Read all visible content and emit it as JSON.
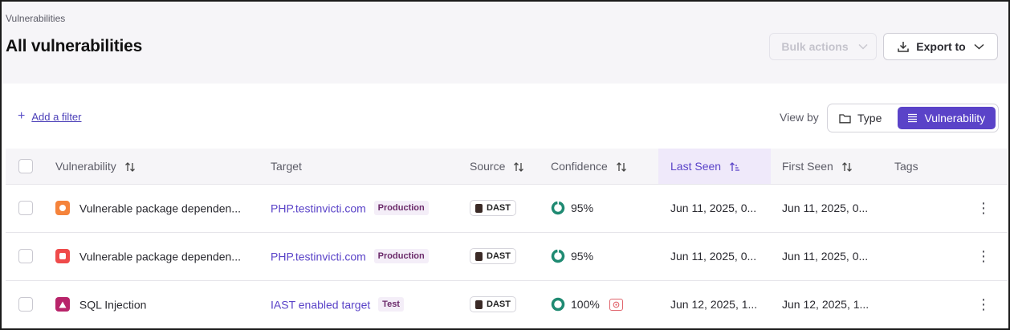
{
  "breadcrumb": "Vulnerabilities",
  "title": "All vulnerabilities",
  "toolbar": {
    "bulk_label": "Bulk actions",
    "export_label": "Export to"
  },
  "filter": {
    "add_label": "Add a filter"
  },
  "view": {
    "label": "View by",
    "options": [
      "Type",
      "Vulnerability"
    ],
    "selected": "Vulnerability"
  },
  "columns": {
    "vulnerability": "Vulnerability",
    "target": "Target",
    "source": "Source",
    "confidence": "Confidence",
    "last_seen": "Last Seen",
    "first_seen": "First Seen",
    "tags": "Tags"
  },
  "rows": [
    {
      "severity": "high",
      "severity_color": "#f5833b",
      "name": "Vulnerable package dependen...",
      "target": "PHP.testinvicti.com",
      "env": "Production",
      "source": "DAST",
      "confidence": "95%",
      "last_seen": "Jun 11, 2025, 0...",
      "first_seen": "Jun 11, 2025, 0..."
    },
    {
      "severity": "critical",
      "severity_color": "#ef4b4b",
      "name": "Vulnerable package dependen...",
      "target": "PHP.testinvicti.com",
      "env": "Production",
      "source": "DAST",
      "confidence": "95%",
      "last_seen": "Jun 11, 2025, 0...",
      "first_seen": "Jun 11, 2025, 0..."
    },
    {
      "severity": "critical-triangle",
      "severity_color": "#b8246a",
      "name": "SQL Injection",
      "target": "IAST enabled target",
      "env": "Test",
      "source": "DAST",
      "confidence": "100%",
      "last_seen": "Jun 12, 2025, 1...",
      "first_seen": "Jun 12, 2025, 1..."
    }
  ],
  "colors": {
    "accent": "#5a43c8",
    "confidence": "#1f8a72"
  }
}
